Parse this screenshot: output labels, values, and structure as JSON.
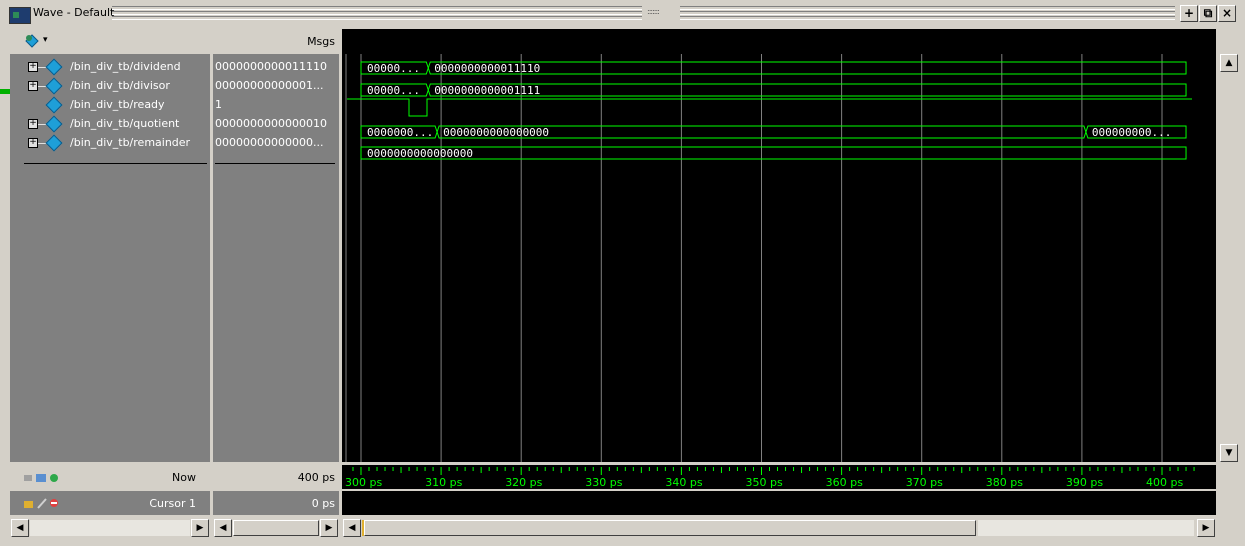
{
  "window": {
    "title": "Wave - Default",
    "buttons": [
      "+",
      "⧉",
      "×"
    ]
  },
  "headers": {
    "msgs": "Msgs"
  },
  "signals": [
    {
      "name": "/bin_div_tb/dividend",
      "value": "0000000000011110",
      "expandable": true
    },
    {
      "name": "/bin_div_tb/divisor",
      "value": "00000000000001...",
      "expandable": true
    },
    {
      "name": "/bin_div_tb/ready",
      "value": "1",
      "expandable": false
    },
    {
      "name": "/bin_div_tb/quotient",
      "value": "0000000000000010",
      "expandable": true
    },
    {
      "name": "/bin_div_tb/remainder",
      "value": "00000000000000...",
      "expandable": true
    }
  ],
  "waves": {
    "dividend": [
      "00000...",
      "0000000000011110"
    ],
    "divisor": [
      "00000...",
      "0000000000001111"
    ],
    "quotient": [
      "0000000...",
      "0000000000000000",
      "000000000..."
    ],
    "remainder": [
      "0000000000000000"
    ]
  },
  "bottom": {
    "now_label": "Now",
    "now_value": "400 ps",
    "cursor_label": "Cursor 1",
    "cursor_value": "0 ps"
  },
  "timeline": {
    "ticks": [
      "300 ps",
      "310 ps",
      "320 ps",
      "330 ps",
      "340 ps",
      "350 ps",
      "360 ps",
      "370 ps",
      "380 ps",
      "390 ps",
      "400 ps"
    ],
    "range_ps": [
      300,
      400
    ],
    "color": "#00ff00"
  },
  "colors": {
    "wave": "#00ff00",
    "panel_bg": "#808080",
    "wave_bg": "#000000",
    "grid": "#808080"
  }
}
